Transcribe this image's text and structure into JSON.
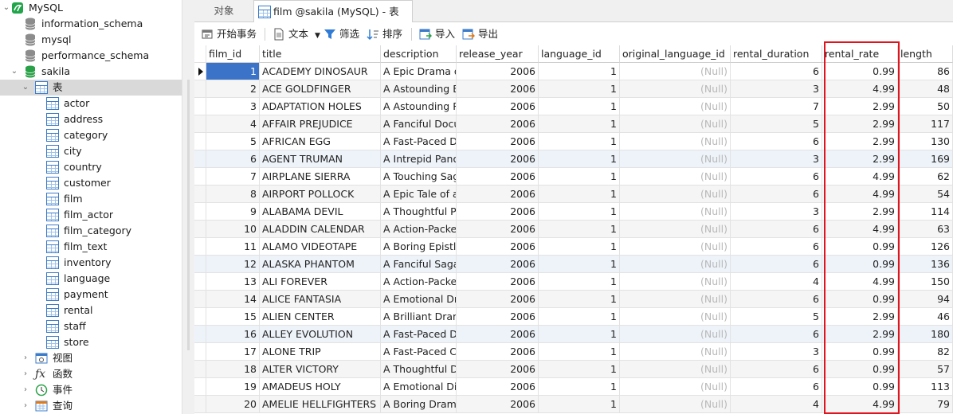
{
  "nav": {
    "connection": "MySQL",
    "databases": [
      "information_schema",
      "mysql",
      "performance_schema",
      "sakila"
    ],
    "tables_label": "表",
    "tables": [
      "actor",
      "address",
      "category",
      "city",
      "country",
      "customer",
      "film",
      "film_actor",
      "film_category",
      "film_text",
      "inventory",
      "language",
      "payment",
      "rental",
      "staff",
      "store"
    ],
    "groups": [
      {
        "label": "视图",
        "icon": "view-icon"
      },
      {
        "label": "函数",
        "icon": "function-icon"
      },
      {
        "label": "事件",
        "icon": "event-icon"
      },
      {
        "label": "查询",
        "icon": "query-icon"
      }
    ]
  },
  "tabs": {
    "objects": "对象",
    "active": "film @sakila (MySQL) - 表"
  },
  "toolbar": {
    "begin_transaction": "开始事务",
    "text": "文本",
    "filter": "筛选",
    "sort": "排序",
    "import": "导入",
    "export": "导出"
  },
  "grid": {
    "columns": [
      "film_id",
      "title",
      "description",
      "release_year",
      "language_id",
      "original_language_id",
      "rental_duration",
      "rental_rate",
      "length"
    ],
    "null_text": "(Null)",
    "rows": [
      [
        "1",
        "ACADEMY DINOSAUR",
        "A Epic Drama of",
        "2006",
        "1",
        "(Null)",
        "6",
        "0.99",
        "86"
      ],
      [
        "2",
        "ACE GOLDFINGER",
        "A Astounding Ep",
        "2006",
        "1",
        "(Null)",
        "3",
        "4.99",
        "48"
      ],
      [
        "3",
        "ADAPTATION HOLES",
        "A Astounding Re",
        "2006",
        "1",
        "(Null)",
        "7",
        "2.99",
        "50"
      ],
      [
        "4",
        "AFFAIR PREJUDICE",
        "A Fanciful Docur",
        "2006",
        "1",
        "(Null)",
        "5",
        "2.99",
        "117"
      ],
      [
        "5",
        "AFRICAN EGG",
        "A Fast-Paced Do",
        "2006",
        "1",
        "(Null)",
        "6",
        "2.99",
        "130"
      ],
      [
        "6",
        "AGENT TRUMAN",
        "A Intrepid Panor",
        "2006",
        "1",
        "(Null)",
        "3",
        "2.99",
        "169"
      ],
      [
        "7",
        "AIRPLANE SIERRA",
        "A Touching Saga",
        "2006",
        "1",
        "(Null)",
        "6",
        "4.99",
        "62"
      ],
      [
        "8",
        "AIRPORT POLLOCK",
        "A Epic Tale of a",
        "2006",
        "1",
        "(Null)",
        "6",
        "4.99",
        "54"
      ],
      [
        "9",
        "ALABAMA DEVIL",
        "A Thoughtful Pa",
        "2006",
        "1",
        "(Null)",
        "3",
        "2.99",
        "114"
      ],
      [
        "10",
        "ALADDIN CALENDAR",
        "A Action-Packed",
        "2006",
        "1",
        "(Null)",
        "6",
        "4.99",
        "63"
      ],
      [
        "11",
        "ALAMO VIDEOTAPE",
        "A Boring Epistle",
        "2006",
        "1",
        "(Null)",
        "6",
        "0.99",
        "126"
      ],
      [
        "12",
        "ALASKA PHANTOM",
        "A Fanciful Saga",
        "2006",
        "1",
        "(Null)",
        "6",
        "0.99",
        "136"
      ],
      [
        "13",
        "ALI FOREVER",
        "A Action-Packed",
        "2006",
        "1",
        "(Null)",
        "4",
        "4.99",
        "150"
      ],
      [
        "14",
        "ALICE FANTASIA",
        "A Emotional Dra",
        "2006",
        "1",
        "(Null)",
        "6",
        "0.99",
        "94"
      ],
      [
        "15",
        "ALIEN CENTER",
        "A Brilliant Dram",
        "2006",
        "1",
        "(Null)",
        "5",
        "2.99",
        "46"
      ],
      [
        "16",
        "ALLEY EVOLUTION",
        "A Fast-Paced Dr",
        "2006",
        "1",
        "(Null)",
        "6",
        "2.99",
        "180"
      ],
      [
        "17",
        "ALONE TRIP",
        "A Fast-Paced Ch",
        "2006",
        "1",
        "(Null)",
        "3",
        "0.99",
        "82"
      ],
      [
        "18",
        "ALTER VICTORY",
        "A Thoughtful Dr",
        "2006",
        "1",
        "(Null)",
        "6",
        "0.99",
        "57"
      ],
      [
        "19",
        "AMADEUS HOLY",
        "A Emotional Dis",
        "2006",
        "1",
        "(Null)",
        "6",
        "0.99",
        "113"
      ],
      [
        "20",
        "AMELIE HELLFIGHTERS",
        "A Boring Drama",
        "2006",
        "1",
        "(Null)",
        "4",
        "4.99",
        "79"
      ]
    ]
  },
  "colors": {
    "highlight_box": "#e0141e",
    "selected_cell": "#3b73c9",
    "null_text": "#b9b9b9"
  }
}
